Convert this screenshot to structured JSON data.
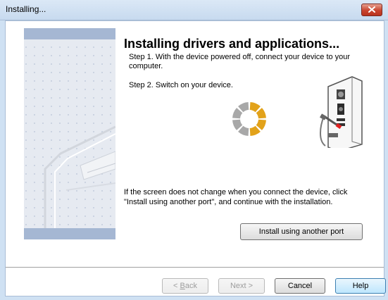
{
  "window": {
    "title": "Installing..."
  },
  "main": {
    "heading": "Installing drivers and applications...",
    "step1": "Step 1. With the device powered off, connect your device to your computer.",
    "step2": "Step 2. Switch on your device.",
    "info": "If the screen does not change when you connect the device, click \"Install using another port\", and continue with the installation.",
    "another_port_button": "Install using another port"
  },
  "footer": {
    "back": {
      "prefix": "< ",
      "accel": "B",
      "rest": "ack"
    },
    "next": {
      "label": "Next >"
    },
    "cancel": "Cancel",
    "help": "Help"
  },
  "colors": {
    "spinner_active": "#e2a21a",
    "spinner_inactive": "#a8a8a8",
    "cable_red": "#e02020",
    "title_bar": "#cfe1f3",
    "left_band": "#a5b7d3"
  },
  "icons": [
    "close-icon",
    "loading-spinner-icon",
    "computer-cable-icon",
    "printer-illustration"
  ]
}
